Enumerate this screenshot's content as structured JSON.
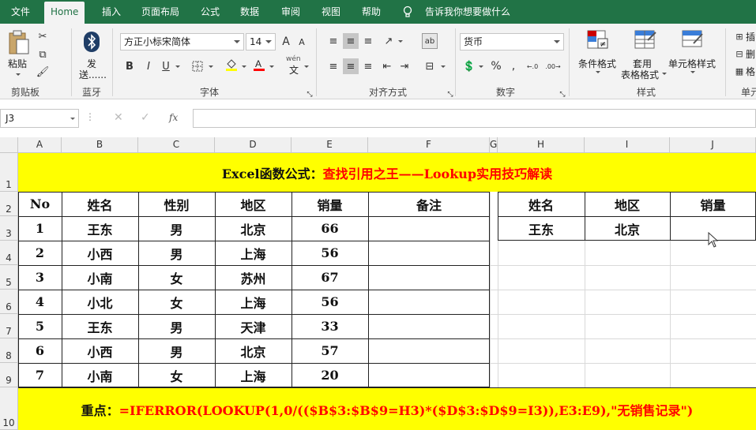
{
  "tabs": [
    "文件",
    "Home",
    "插入",
    "页面布局",
    "公式",
    "数据",
    "审阅",
    "视图",
    "帮助",
    "告诉我你想要做什么"
  ],
  "ribbon": {
    "clipboard": {
      "paste": "粘贴",
      "group": "剪贴板"
    },
    "bluetooth": {
      "send1": "发",
      "send2": "送......",
      "group": "蓝牙"
    },
    "font": {
      "name": "方正小标宋简体",
      "size": "14",
      "grow": "A",
      "shrink": "A",
      "bold": "B",
      "italic": "I",
      "underline": "U",
      "wen": "wén",
      "wen_char": "文",
      "group": "字体"
    },
    "alignment": {
      "group": "对齐方式"
    },
    "number": {
      "format": "货币",
      "group": "数字",
      "percent": "%"
    },
    "styles": {
      "conditional": "条件格式",
      "table1": "套用",
      "table2": "表格格式",
      "cellstyle": "单元格样式",
      "group": "样式"
    },
    "cells": {
      "insert": "插",
      "delete": "删",
      "format": "格",
      "group": "单元"
    }
  },
  "formula_bar": {
    "name_box": "J3",
    "fx": "fx",
    "content": ""
  },
  "columns": [
    "A",
    "B",
    "C",
    "D",
    "E",
    "F",
    "G",
    "H",
    "I",
    "J"
  ],
  "rows": [
    "1",
    "2",
    "3",
    "4",
    "5",
    "6",
    "7",
    "8",
    "9",
    "10"
  ],
  "title": {
    "prefix": "Excel函数公式：",
    "main": "查找引用之王——Lookup实用技巧解读"
  },
  "table": {
    "headers": [
      "No",
      "姓名",
      "性别",
      "地区",
      "销量",
      "备注"
    ],
    "rows": [
      [
        "1",
        "王东",
        "男",
        "北京",
        "66",
        ""
      ],
      [
        "2",
        "小西",
        "男",
        "上海",
        "56",
        ""
      ],
      [
        "3",
        "小南",
        "女",
        "苏州",
        "67",
        ""
      ],
      [
        "4",
        "小北",
        "女",
        "上海",
        "56",
        ""
      ],
      [
        "5",
        "王东",
        "男",
        "天津",
        "33",
        ""
      ],
      [
        "6",
        "小西",
        "男",
        "北京",
        "57",
        ""
      ],
      [
        "7",
        "小南",
        "女",
        "上海",
        "20",
        ""
      ]
    ]
  },
  "lookup": {
    "headers": [
      "姓名",
      "地区",
      "销量"
    ],
    "values": [
      "王东",
      "北京",
      ""
    ]
  },
  "footer": {
    "label": "重点：",
    "formula": "=IFERROR(LOOKUP(1,0/(($B$3:$B$9=H3)*($D$3:$D$9=I3)),E3:E9),\"无销售记录\")"
  },
  "colors": {
    "excel_green": "#217346",
    "highlight": "#ffff00",
    "red_text": "#ff0000"
  }
}
